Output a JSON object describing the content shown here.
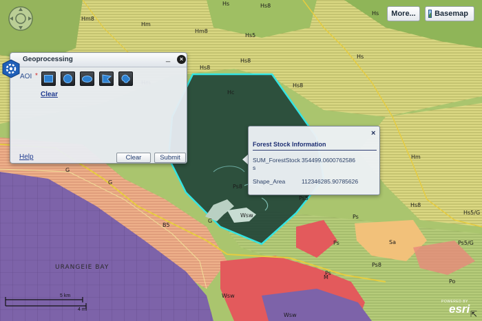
{
  "toolbar": {
    "more_label": "More...",
    "basemap_label": "Basemap"
  },
  "geoprocessing": {
    "title": "Geoprocessing",
    "minimize": "_",
    "close": "×",
    "aoi_label": "AOI",
    "required_mark": "*",
    "draw_tools": [
      "rectangle",
      "circle",
      "ellipse",
      "polygon",
      "freehand"
    ],
    "clear_link": "Clear",
    "help_link": "Help",
    "clear_button": "Clear",
    "submit_button": "Submit"
  },
  "popup": {
    "title": "Forest Stock Information",
    "close": "×",
    "fields": [
      {
        "name": "SUM_ForestStocks",
        "value": "354499.0600762586"
      },
      {
        "name": "Shape_Area",
        "value": "112346285.90785626"
      }
    ]
  },
  "map_labels": [
    "Hm8",
    "Hm",
    "Hm8",
    "Hs8",
    "Hs",
    "Hs5",
    "Hs8",
    "Hs",
    "Hs8",
    "G",
    "G",
    "B5",
    "Ps8",
    "Ps5",
    "Wsw",
    "Hm",
    "Hs8",
    "Hs5/G",
    "Ps",
    "Sa",
    "Ps5/G",
    "Ps8",
    "Po",
    "Hm",
    "Hs8",
    "G",
    "Ps",
    "Ps",
    "M",
    "Wsw",
    "Wsw",
    "Hs",
    "Hc"
  ],
  "map_place_label": "URANGEIE BAY",
  "scale": {
    "km_label": "5 km",
    "mi_label": "4 mi"
  },
  "attribution": {
    "powered_by": "POWERED BY",
    "logo": "esri"
  },
  "colors": {
    "aoi_fill": "#1f4237",
    "aoi_outline": "#34e4e2",
    "purple_zone": "#7b5fa6",
    "green_zone": "#a9c06c",
    "red_zone": "#e05a5c",
    "yellow_hatch": "#d8d56a"
  }
}
